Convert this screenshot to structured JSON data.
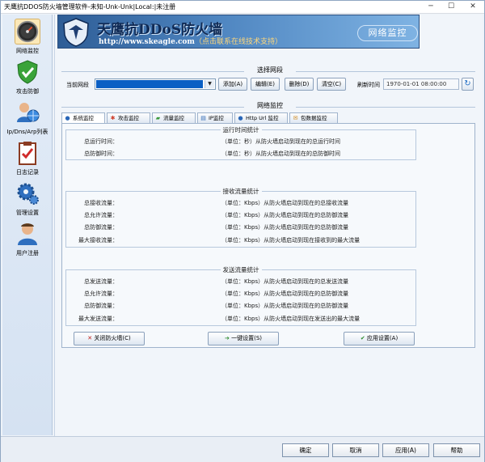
{
  "window": {
    "title": "天鹰抗DDOS防火墙管理软件-未知-Unk-Unk|Local:|未注册",
    "min_glyph": "─",
    "max_glyph": "☐",
    "close_glyph": "✕"
  },
  "sidebar": {
    "items": [
      {
        "label": "网络监控",
        "icon": "gauge-icon"
      },
      {
        "label": "攻击防御",
        "icon": "shield-check-icon"
      },
      {
        "label": "Ip/Dns/Arp列表",
        "icon": "user-globe-icon"
      },
      {
        "label": "日志记录",
        "icon": "clipboard-check-icon"
      },
      {
        "label": "管理设置",
        "icon": "gear-icon"
      },
      {
        "label": "用户注册",
        "icon": "user-icon"
      }
    ]
  },
  "banner": {
    "title": "天鹰抗DDoS防火墙",
    "url": "http://www.skeagle.com",
    "hint": "（点击联系在线技术支持）",
    "right_text": "网络监控"
  },
  "select_segment": {
    "group_title": "选择网段",
    "current_label": "当前网段",
    "add": "添加(A)",
    "edit": "编辑(E)",
    "delete": "删除(D)",
    "clear": "清空(C)",
    "refresh_label": "刷新时间",
    "refresh_time": "1970-01-01 08:00:00",
    "refresh_glyph": "↻"
  },
  "monitor": {
    "group_title": "网络监控",
    "tabs": [
      {
        "label": "系统监控",
        "glyph": "●",
        "color": "#2a67b8"
      },
      {
        "label": "攻击监控",
        "glyph": "✱",
        "color": "#d0402c"
      },
      {
        "label": "流量监控",
        "glyph": "▰",
        "color": "#3b9a3b"
      },
      {
        "label": "IP监控",
        "glyph": "▤",
        "color": "#3069b4"
      },
      {
        "label": "Http Url 监控",
        "glyph": "●",
        "color": "#2a67b8"
      },
      {
        "label": "包数据监控",
        "glyph": "✉",
        "color": "#d28a1d"
      }
    ]
  },
  "runtime_stats": {
    "title": "运行时间统计",
    "rows": [
      {
        "key": "总运行时间：",
        "desc": "（单位：秒）从防火墙启动到现在的总运行时间"
      },
      {
        "key": "总防御时间：",
        "desc": "（单位：秒）从防火墙启动到现在的总防御时间"
      }
    ]
  },
  "recv_stats": {
    "title": "接收流量统计",
    "rows": [
      {
        "key": "总接收流量：",
        "desc": "（单位：Kbps）从防火墙启动到现在的总接收流量"
      },
      {
        "key": "总允许流量：",
        "desc": "（单位：Kbps）从防火墙启动到现在的总防御流量"
      },
      {
        "key": "总防御流量：",
        "desc": "（单位：Kbps）从防火墙启动到现在的总防御流量"
      },
      {
        "key": "最大接收流量：",
        "desc": "（单位：Kbps）从防火墙启动到现在接收到的最大流量"
      }
    ]
  },
  "send_stats": {
    "title": "发送流量统计",
    "rows": [
      {
        "key": "总发送流量：",
        "desc": "（单位：Kbps）从防火墙启动到现在的总发送流量"
      },
      {
        "key": "总允许流量：",
        "desc": "（单位：Kbps）从防火墙启动到现在的总防御流量"
      },
      {
        "key": "总防御流量：",
        "desc": "（单位：Kbps）从防火墙启动到现在的总防御流量"
      },
      {
        "key": "最大发送流量：",
        "desc": "（单位：Kbps）从防火墙启动到现在发送出的最大流量"
      }
    ]
  },
  "actions": {
    "close_fw": "关闭防火墙(C)",
    "one_key": "一键设置(S)",
    "apply": "应用设置(A)",
    "close_glyph": "✕",
    "one_key_glyph": "➔",
    "apply_glyph": "✔"
  },
  "footer": {
    "ok": "确定",
    "cancel": "取消",
    "apply": "应用(A)",
    "help": "帮助"
  }
}
